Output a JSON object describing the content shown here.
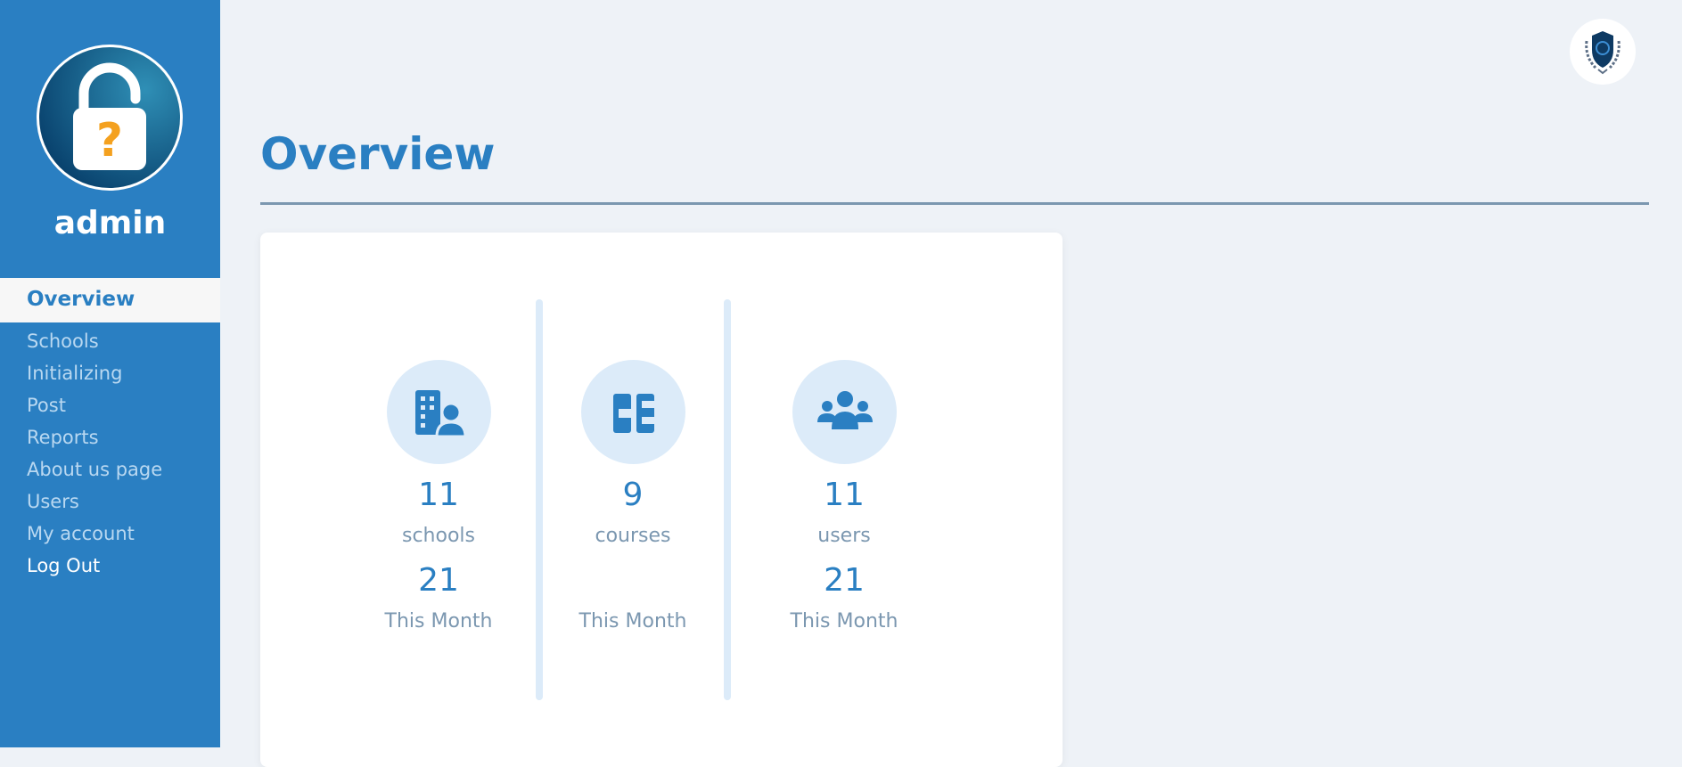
{
  "sidebar": {
    "username": "admin",
    "avatar_icon": "unlocked-padlock-question-icon",
    "active_item": "Overview",
    "items": [
      {
        "label": "Schools"
      },
      {
        "label": "Initializing"
      },
      {
        "label": "Post"
      },
      {
        "label": "Reports"
      },
      {
        "label": "About us page"
      },
      {
        "label": "Users"
      },
      {
        "label": "My account"
      },
      {
        "label": "Log Out"
      }
    ]
  },
  "header": {
    "logo_icon": "shield-laurel-logo-icon"
  },
  "main": {
    "title": "Overview",
    "stats": [
      {
        "icon": "building-user-icon",
        "value": "11",
        "label": "schools",
        "month_value": "21",
        "month_label": "This Month"
      },
      {
        "icon": "book-columns-icon",
        "value": "9",
        "label": "courses",
        "month_value": "",
        "month_label": "This Month"
      },
      {
        "icon": "users-group-icon",
        "value": "11",
        "label": "users",
        "month_value": "21",
        "month_label": "This Month"
      }
    ]
  },
  "colors": {
    "primary": "#2a7fc2",
    "page_background": "#eef2f7",
    "muted_text": "#7b97b0",
    "icon_circle": "#dcebf9",
    "accent_orange": "#f4a11f"
  }
}
